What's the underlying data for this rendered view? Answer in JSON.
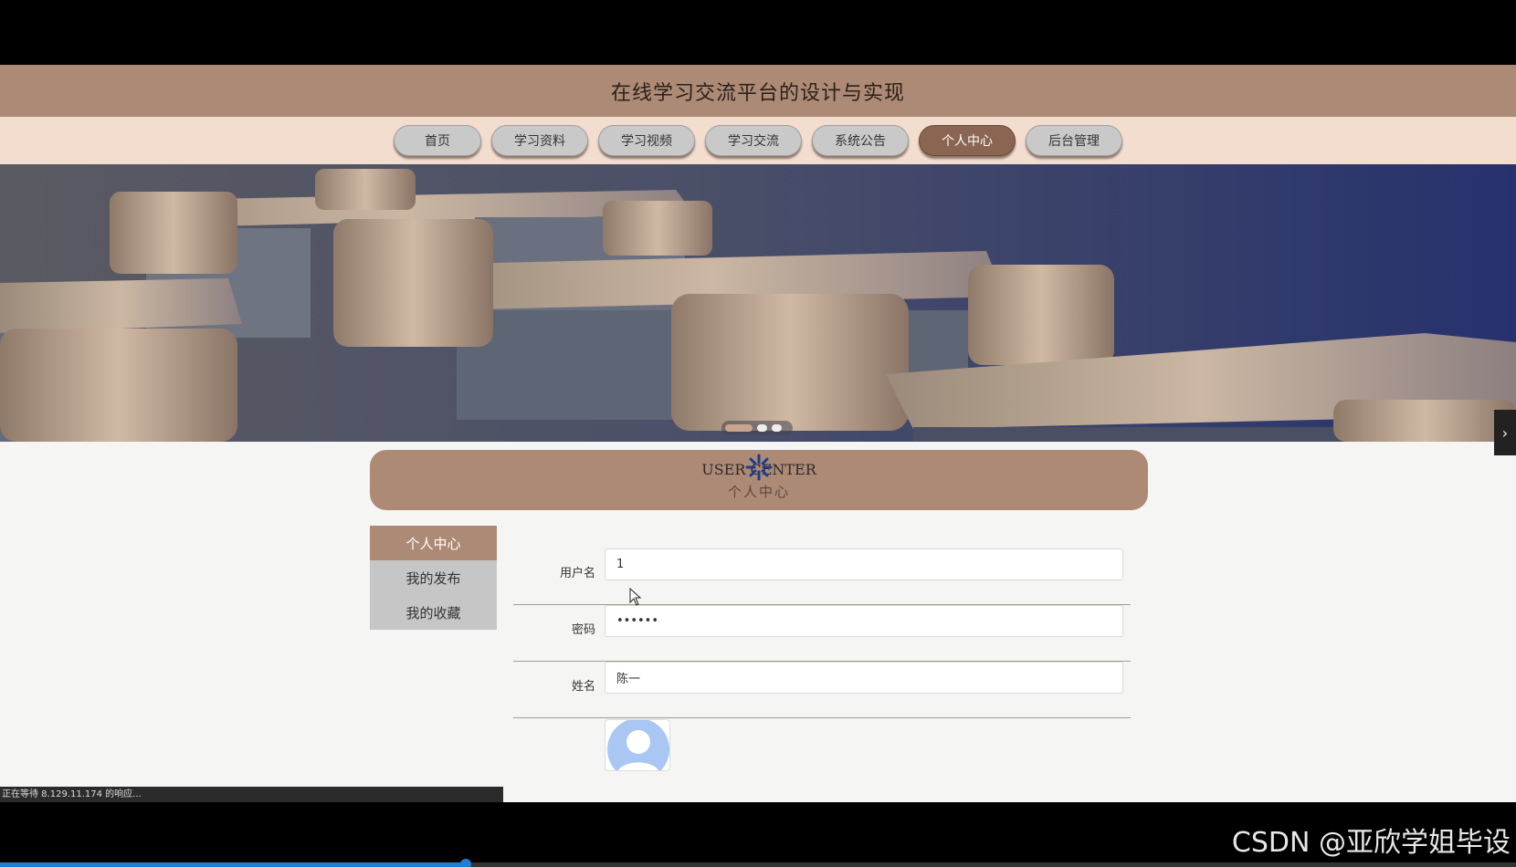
{
  "site": {
    "title": "在线学习交流平台的设计与实现"
  },
  "nav": {
    "items": [
      {
        "label": "首页"
      },
      {
        "label": "学习资料"
      },
      {
        "label": "学习视频"
      },
      {
        "label": "学习交流"
      },
      {
        "label": "系统公告"
      },
      {
        "label": "个人中心",
        "active": true
      },
      {
        "label": "后台管理"
      }
    ]
  },
  "banner": {
    "slides_total": 3,
    "active_slide": 1,
    "next_arrow": "›"
  },
  "user_center": {
    "title_en": "USER CENTER",
    "title_cn": "个人中心"
  },
  "side_menu": {
    "items": [
      {
        "label": "个人中心",
        "active": true
      },
      {
        "label": "我的发布"
      },
      {
        "label": "我的收藏"
      }
    ]
  },
  "form": {
    "username": {
      "label": "用户名",
      "value": "1"
    },
    "password": {
      "label": "密码",
      "value": "••••••"
    },
    "name": {
      "label": "姓名",
      "value": "陈一"
    },
    "avatar_icon": "default-avatar-icon"
  },
  "status_bar": {
    "text": "正在等待 8.129.11.174 的响应..."
  },
  "watermark": {
    "text": "CSDN @亚欣学姐毕设"
  },
  "player": {
    "progress": 0.307
  },
  "colors": {
    "header": "#ad8a75",
    "nav_bg": "#f3ddcf",
    "active_nav": "#8a6552"
  }
}
